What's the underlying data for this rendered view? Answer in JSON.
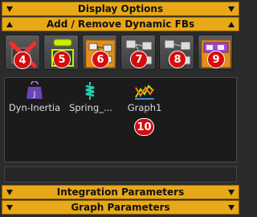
{
  "sections": {
    "display_options": "Display Options",
    "add_remove": "Add / Remove Dynamic FBs",
    "integration": "Integration Parameters",
    "graph": "Graph Parameters"
  },
  "toolbar": {
    "buttons": [
      {
        "icon": "remove-fb-icon",
        "badge": "4"
      },
      {
        "icon": "add-fb-icon",
        "badge": "5"
      },
      {
        "icon": "fb-network-icon",
        "badge": "6"
      },
      {
        "icon": "connect-fb-icon",
        "badge": "7"
      },
      {
        "icon": "disconnect-fb-icon",
        "badge": "8"
      },
      {
        "icon": "fb-group-icon",
        "badge": "9"
      }
    ]
  },
  "fb_list": {
    "items": [
      {
        "label": "Dyn-Inertia",
        "icon": "weight-icon"
      },
      {
        "label": "Spring_...",
        "icon": "spring-icon"
      },
      {
        "label": "Graph1",
        "icon": "graph-icon"
      }
    ],
    "badge": "10"
  },
  "colors": {
    "header": "#e8a817",
    "badge": "#d60c0c",
    "background": "#2b2b2b"
  }
}
